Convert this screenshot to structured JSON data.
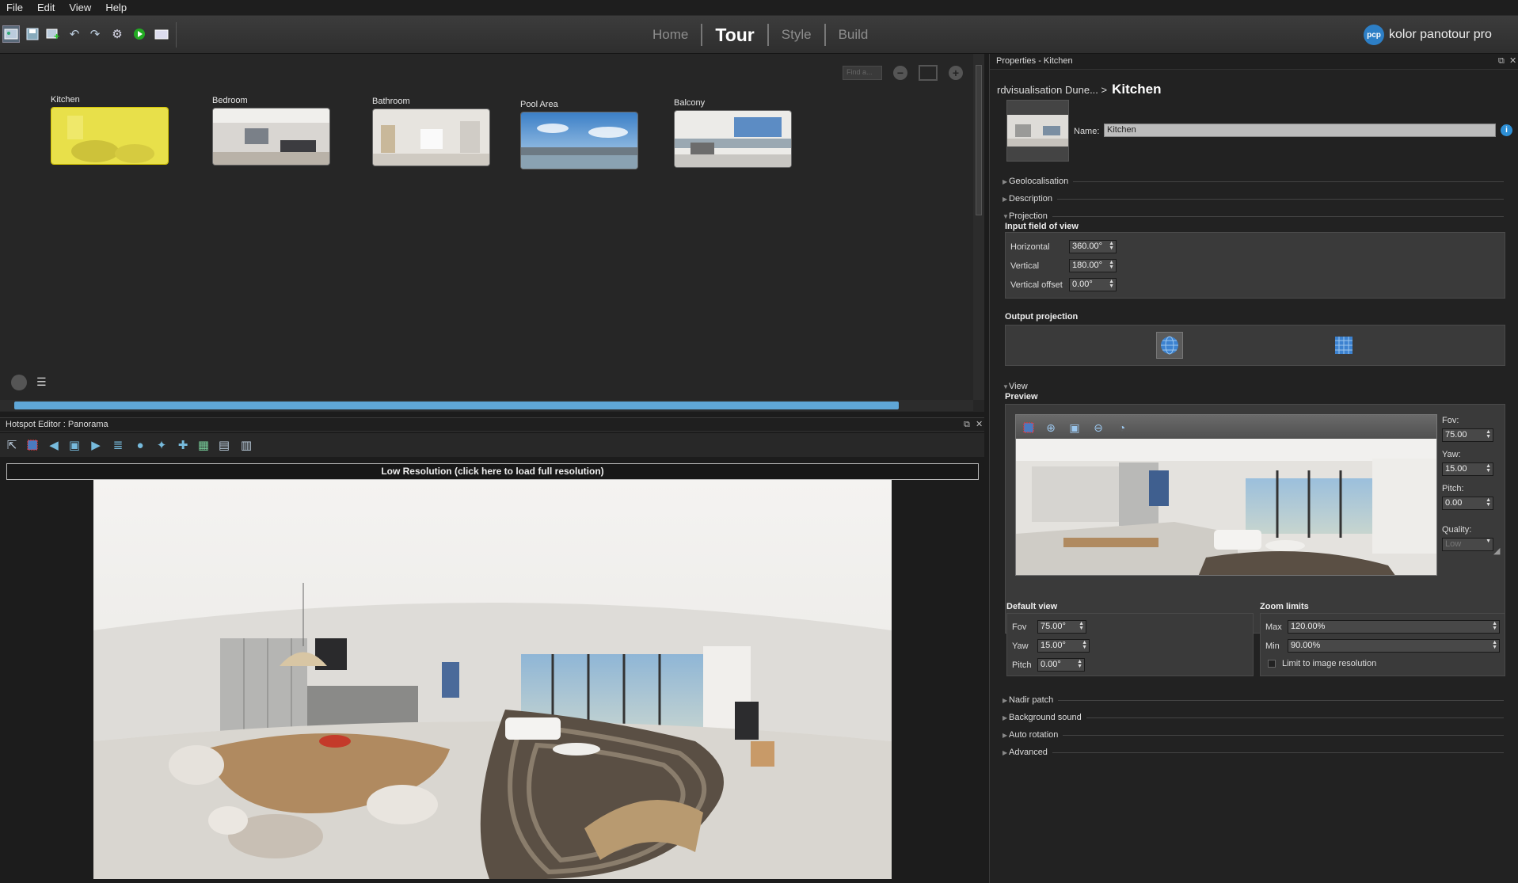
{
  "menu": [
    "File",
    "Edit",
    "View",
    "Help"
  ],
  "tabs": [
    "Home",
    "Tour",
    "Style",
    "Build"
  ],
  "active_tab": "Tour",
  "brand": {
    "logo_text": "pcp",
    "name": "kolor panotour pro"
  },
  "panoramas": [
    {
      "label": "Kitchen",
      "selected": true
    },
    {
      "label": "Bedroom",
      "selected": false
    },
    {
      "label": "Bathroom",
      "selected": false
    },
    {
      "label": "Pool Area",
      "selected": false
    },
    {
      "label": "Balcony",
      "selected": false
    }
  ],
  "find_placeholder": "Find a...",
  "hotspot_editor": {
    "title": "Hotspot Editor : Panorama",
    "lowres_notice": "Low Resolution (click here to load full resolution)"
  },
  "properties": {
    "title": "Properties - Kitchen",
    "breadcrumb_parent": "rdvisualisation Dune... >",
    "breadcrumb_current": "Kitchen",
    "name_label": "Name:",
    "name_value": "Kitchen",
    "sections": {
      "geolocalisation": "Geolocalisation",
      "description": "Description",
      "projection": "Projection",
      "view": "View",
      "nadir": "Nadir patch",
      "sound": "Background sound",
      "autorot": "Auto rotation",
      "advanced": "Advanced"
    },
    "input_fov": {
      "title": "Input field of view",
      "horizontal_label": "Horizontal",
      "horizontal": "360.00°",
      "vertical_label": "Vertical",
      "vertical": "180.00°",
      "offset_label": "Vertical offset",
      "offset": "0.00°"
    },
    "output_projection": "Output projection",
    "preview": {
      "title": "Preview",
      "fov_label": "Fov:",
      "fov": "75.00",
      "yaw_label": "Yaw:",
      "yaw": "15.00",
      "pitch_label": "Pitch:",
      "pitch": "0.00",
      "quality_label": "Quality:",
      "quality": "Low"
    },
    "default_view": {
      "title": "Default view",
      "fov_label": "Fov",
      "fov": "75.00°",
      "yaw_label": "Yaw",
      "yaw": "15.00°",
      "pitch_label": "Pitch",
      "pitch": "0.00°"
    },
    "zoom_limits": {
      "title": "Zoom limits",
      "max_label": "Max",
      "max": "120.00%",
      "min_label": "Min",
      "min": "90.00%",
      "limit_label": "Limit to image resolution"
    }
  },
  "colors": {
    "accent": "#2d7fc6",
    "selection": "#e8e04a"
  }
}
